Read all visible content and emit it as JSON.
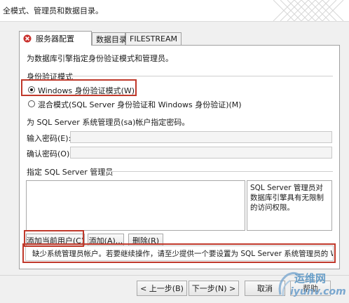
{
  "header": {
    "text": "全模式、管理员和数据目录。"
  },
  "tabs": [
    {
      "label": "服务器配置",
      "has_error": true,
      "active": true
    },
    {
      "label": "数据目录"
    },
    {
      "label": "FILESTREAM"
    }
  ],
  "panel": {
    "intro": "为数据库引擎指定身份验证模式和管理员。",
    "auth_group_label": "身份验证模式",
    "radio_windows": "Windows 身份验证模式(W)",
    "radio_mixed": "混合模式(SQL Server 身份验证和 Windows 身份验证)(M)",
    "sa_hint": "为 SQL Server 系统管理员(sa)帐户指定密码。",
    "password_label": "输入密码(E):",
    "confirm_label": "确认密码(O):",
    "admins_group_label": "指定 SQL Server 管理员",
    "admins_desc": "SQL Server 管理员对数据库引擎具有无限制的访问权限。",
    "add_current_user": "添加当前用户(C)",
    "add": "添加(A)...",
    "remove": "删除(R)",
    "error_message": "缺少系统管理员帐户。若要继续操作，请至少提供一个要设置为 SQL Server 系统管理员的 Win..."
  },
  "footer": {
    "back": "< 上一步(B)",
    "next": "下一步(N) >",
    "cancel": "取消",
    "help": "帮助"
  },
  "watermark": {
    "line1": "运维网",
    "line2": "iyunv.com"
  },
  "colors": {
    "highlight": "#c0392b",
    "error_icon": "#c9302c"
  }
}
